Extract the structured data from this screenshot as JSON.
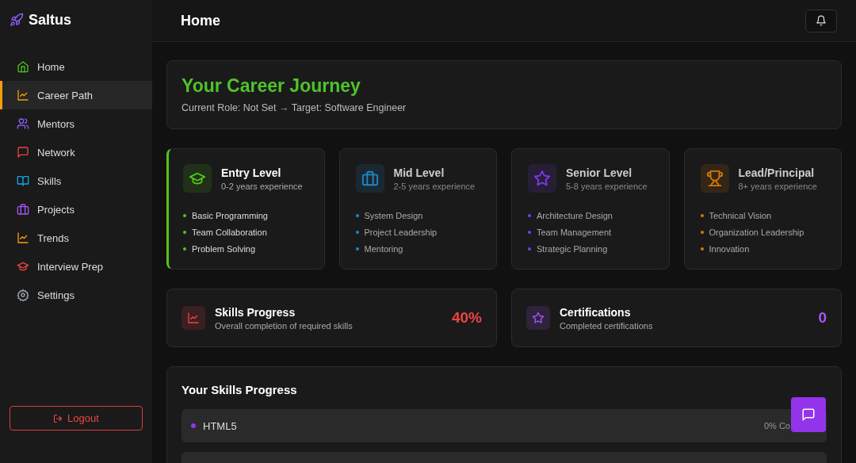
{
  "brand": "Saltus",
  "nav": [
    {
      "label": "Home",
      "selected": false
    },
    {
      "label": "Career Path",
      "selected": true
    },
    {
      "label": "Mentors",
      "selected": false
    },
    {
      "label": "Network",
      "selected": false
    },
    {
      "label": "Skills",
      "selected": false
    },
    {
      "label": "Projects",
      "selected": false
    },
    {
      "label": "Trends",
      "selected": false
    },
    {
      "label": "Interview Prep",
      "selected": false
    },
    {
      "label": "Settings",
      "selected": false
    }
  ],
  "logout": "Logout",
  "header": {
    "title": "Home"
  },
  "journey": {
    "title": "Your Career Journey",
    "subtitle": "Current Role: Not Set → Target: Software Engineer"
  },
  "levels": [
    {
      "title": "Entry Level",
      "years": "0-2 years experience",
      "color": "#52c41a",
      "selected": true,
      "skills": [
        "Basic Programming",
        "Team Collaboration",
        "Problem Solving"
      ]
    },
    {
      "title": "Mid Level",
      "years": "2-5 years experience",
      "color": "#1e88c7",
      "selected": false,
      "skills": [
        "System Design",
        "Project Leadership",
        "Mentoring"
      ]
    },
    {
      "title": "Senior Level",
      "years": "5-8 years experience",
      "color": "#7c3aed",
      "selected": false,
      "skills": [
        "Architecture Design",
        "Team Management",
        "Strategic Planning"
      ]
    },
    {
      "title": "Lead/Principal",
      "years": "8+ years experience",
      "color": "#d97706",
      "selected": false,
      "skills": [
        "Technical Vision",
        "Organization Leadership",
        "Innovation"
      ]
    }
  ],
  "stats": [
    {
      "title": "Skills Progress",
      "subtitle": "Overall completion of required skills",
      "value": "40%",
      "color": "#ef4444"
    },
    {
      "title": "Certifications",
      "subtitle": "Completed certifications",
      "value": "0",
      "color": "#a855f7"
    }
  ],
  "skills_progress": {
    "title": "Your Skills Progress",
    "rows": [
      {
        "name": "HTML5",
        "status": "0% Co",
        "color": "#9333ea"
      }
    ]
  }
}
